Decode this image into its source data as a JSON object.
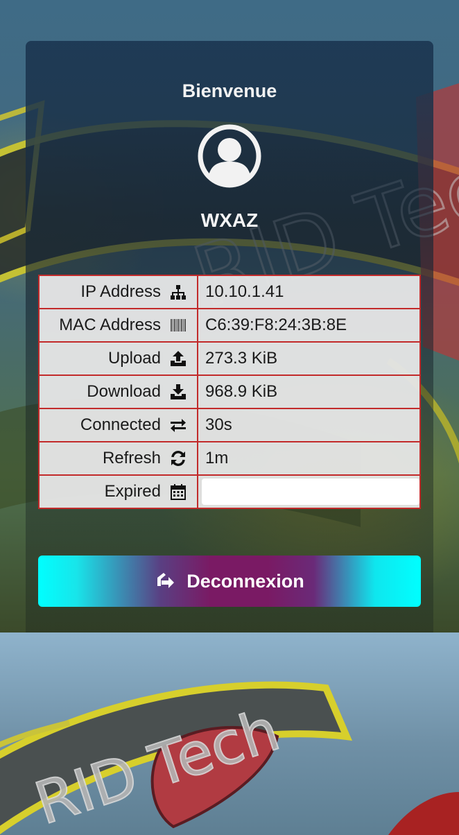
{
  "header": {
    "welcome": "Bienvenue"
  },
  "user": {
    "name": "WXAZ",
    "avatar_icon": "user-circle-icon"
  },
  "info_rows": [
    {
      "label": "IP Address",
      "icon": "network-icon",
      "value": "10.10.1.41"
    },
    {
      "label": "MAC Address",
      "icon": "barcode-icon",
      "value": "C6:39:F8:24:3B:8E"
    },
    {
      "label": "Upload",
      "icon": "upload-icon",
      "value": "273.3 KiB"
    },
    {
      "label": "Download",
      "icon": "download-icon",
      "value": "968.9 KiB"
    },
    {
      "label": "Connected",
      "icon": "exchange-icon",
      "value": "30s"
    },
    {
      "label": "Refresh",
      "icon": "refresh-icon",
      "value": "1m"
    },
    {
      "label": "Expired",
      "icon": "calendar-icon",
      "value": ""
    }
  ],
  "actions": {
    "logout_label": "Deconnexion",
    "logout_icon": "sign-out-icon"
  },
  "background": {
    "watermark_text": "RID Tech"
  },
  "colors": {
    "table_border": "#c22a2a",
    "button_gradient_edge": "#00ffff",
    "button_gradient_center": "#7a1a64",
    "card_top": "#1c3752"
  }
}
